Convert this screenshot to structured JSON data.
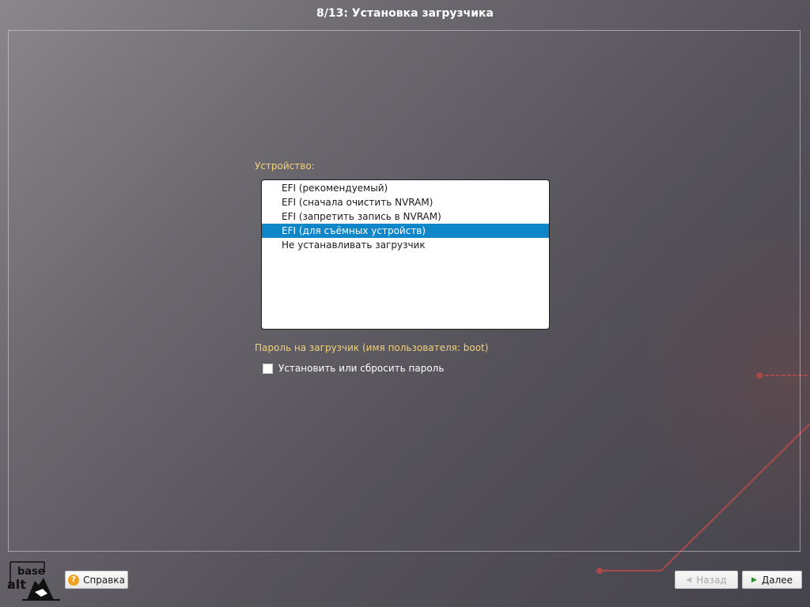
{
  "header": {
    "title": "8/13: Установка загрузчика"
  },
  "device": {
    "label": "Устройство:",
    "options": [
      "EFI (рекомендуемый)",
      "EFI (сначала очистить NVRAM)",
      "EFI (запретить запись в NVRAM)",
      "EFI (для съёмных устройств)",
      "Не устанавливать загрузчик"
    ],
    "selected": "EFI (для съёмных устройств)"
  },
  "password": {
    "label": "Пароль на загрузчик (имя пользователя: boot)",
    "checkbox_label": "Установить или сбросить пароль",
    "checked": false
  },
  "logo": {
    "line1": "base",
    "line2": "alt"
  },
  "footer": {
    "help_label": "Справка",
    "back_label": "Назад",
    "next_label": "Далее"
  },
  "icons": {
    "help": "help-icon",
    "back": "chevron-left-icon",
    "next": "chevron-right-icon"
  },
  "colors": {
    "section_label": "#f0d27a",
    "selection": "#0f86c8",
    "accent_line": "#a84a4a"
  }
}
